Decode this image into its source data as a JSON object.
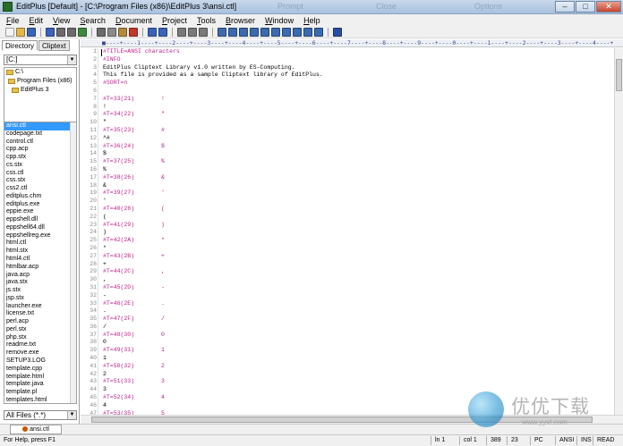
{
  "window": {
    "title": "EditPlus [Default] - [C:\\Program Files (x86)\\EditPlus 3\\ansi.ctl]",
    "ghost_text": [
      "Prompt",
      "Close",
      "Options"
    ]
  },
  "window_controls": {
    "minimize": "–",
    "maximize": "□",
    "close": "✕"
  },
  "menu": [
    {
      "key": "F",
      "rest": "ile"
    },
    {
      "key": "E",
      "rest": "dit"
    },
    {
      "key": "V",
      "rest": "iew"
    },
    {
      "key": "S",
      "rest": "earch"
    },
    {
      "key": "D",
      "rest": "ocument"
    },
    {
      "key": "P",
      "rest": "roject"
    },
    {
      "key": "T",
      "rest": "ools"
    },
    {
      "key": "B",
      "rest": "rowser"
    },
    {
      "key": "W",
      "rest": "indow"
    },
    {
      "key": "H",
      "rest": "elp"
    }
  ],
  "toolbar": {
    "icons": [
      "new-file-icon",
      "open-file-icon",
      "save-icon",
      "save-all-icon",
      "print-icon",
      "print-preview-icon",
      "spell-check-icon",
      "cut-icon",
      "copy-icon",
      "paste-icon",
      "delete-icon",
      "undo-icon",
      "redo-icon",
      "find-icon",
      "replace-icon",
      "go-to-icon",
      "word-wrap-icon",
      "ruler-icon",
      "line-number-icon",
      "screen-width-icon",
      "font-icon",
      "indent-icon",
      "outdent-icon",
      "column-select-icon",
      "html-toolbar-icon",
      "preview-browser-icon",
      "help-icon"
    ],
    "colors": [
      "#f4f4f4",
      "#e1b84a",
      "#3a63b8",
      "#3a63b8",
      "#6b6b6b",
      "#6b6b6b",
      "#3c8a3c",
      "#6b6b6b",
      "#8a8a8a",
      "#b38b3a",
      "#c0392b",
      "#3a63b8",
      "#3a63b8",
      "#7a7a7a",
      "#7a7a7a",
      "#7a7a7a",
      "#3a6ab0",
      "#3a6ab0",
      "#3a6ab0",
      "#3a6ab0",
      "#3a6ab0",
      "#3a6ab0",
      "#3a6ab0",
      "#3a6ab0",
      "#3a6ab0",
      "#3a6ab0",
      "#2a4fa0"
    ]
  },
  "left_panel": {
    "tabs": [
      "Directory",
      "Cliptext"
    ],
    "drive": "[C:]",
    "dirs": [
      "C:\\",
      "Program Files (x86)",
      "EditPlus 3"
    ],
    "files": [
      "ansi.ctl",
      "codepage.txt",
      "control.ctl",
      "cpp.acp",
      "cpp.stx",
      "cs.stx",
      "css.ctl",
      "css.stx",
      "css2.ctl",
      "editplus.chm",
      "editplus.exe",
      "eppie.exe",
      "eppshell.dll",
      "eppshell64.dll",
      "eppshellreg.exe",
      "html.ctl",
      "html.stx",
      "html4.ctl",
      "htmlbar.acp",
      "java.acp",
      "java.stx",
      "js.stx",
      "jsp.stx",
      "launcher.exe",
      "license.txt",
      "perl.acp",
      "perl.stx",
      "php.stx",
      "readme.txt",
      "remove.exe",
      "SETUP3.LOG",
      "template.cpp",
      "template.html",
      "template.java",
      "template.pl",
      "templates.html"
    ],
    "selected_file": "ansi.ctl",
    "filter": "All Files (*.*)"
  },
  "editor": {
    "ruler": "■----+----1----+----2----+----3----+----4----+----5----+----6----+----7----+----8----+----9----+----0----+----1----+----2----+----3----+----4----+",
    "lines": [
      {
        "n": "1",
        "t": "#TITLE=ANSI characters",
        "c": "m"
      },
      {
        "n": "2",
        "t": "#INFO",
        "c": "m"
      },
      {
        "n": "3",
        "t": "EditPlus Cliptext Library v1.0 written by ES-Computing.",
        "c": "p"
      },
      {
        "n": "4",
        "t": "This file is provided as a sample Cliptext library of EditPlus.",
        "c": "p"
      },
      {
        "n": "5",
        "t": "#SORT=n",
        "c": "m"
      },
      {
        "n": "6",
        "t": "",
        "c": "p"
      },
      {
        "n": "7",
        "t": "#T=33(21)",
        "c": "m",
        "ch": "!"
      },
      {
        "n": "8",
        "t": "!",
        "c": "p"
      },
      {
        "n": "9",
        "t": "#T=34(22)",
        "c": "m",
        "ch": "\""
      },
      {
        "n": "10",
        "t": "\"",
        "c": "p"
      },
      {
        "n": "11",
        "t": "#T=35(23)",
        "c": "m",
        "ch": "#"
      },
      {
        "n": "12",
        "t": "^#",
        "c": "p"
      },
      {
        "n": "13",
        "t": "#T=36(24)",
        "c": "m",
        "ch": "$"
      },
      {
        "n": "14",
        "t": "$",
        "c": "p"
      },
      {
        "n": "15",
        "t": "#T=37(25)",
        "c": "m",
        "ch": "%"
      },
      {
        "n": "16",
        "t": "%",
        "c": "p"
      },
      {
        "n": "17",
        "t": "#T=38(26)",
        "c": "m",
        "ch": "&"
      },
      {
        "n": "18",
        "t": "&",
        "c": "p"
      },
      {
        "n": "19",
        "t": "#T=39(27)",
        "c": "m",
        "ch": "'"
      },
      {
        "n": "20",
        "t": "'",
        "c": "p"
      },
      {
        "n": "21",
        "t": "#T=40(28)",
        "c": "m",
        "ch": "("
      },
      {
        "n": "22",
        "t": "(",
        "c": "p"
      },
      {
        "n": "23",
        "t": "#T=41(29)",
        "c": "m",
        "ch": ")"
      },
      {
        "n": "24",
        "t": ")",
        "c": "p"
      },
      {
        "n": "25",
        "t": "#T=42(2A)",
        "c": "m",
        "ch": "*"
      },
      {
        "n": "26",
        "t": "*",
        "c": "p"
      },
      {
        "n": "27",
        "t": "#T=43(2B)",
        "c": "m",
        "ch": "+"
      },
      {
        "n": "28",
        "t": "+",
        "c": "p"
      },
      {
        "n": "29",
        "t": "#T=44(2C)",
        "c": "m",
        "ch": ","
      },
      {
        "n": "30",
        "t": ",",
        "c": "p"
      },
      {
        "n": "31",
        "t": "#T=45(2D)",
        "c": "m",
        "ch": "-"
      },
      {
        "n": "32",
        "t": "-",
        "c": "p"
      },
      {
        "n": "33",
        "t": "#T=46(2E)",
        "c": "m",
        "ch": "."
      },
      {
        "n": "34",
        "t": ".",
        "c": "p"
      },
      {
        "n": "35",
        "t": "#T=47(2F)",
        "c": "m",
        "ch": "/"
      },
      {
        "n": "36",
        "t": "/",
        "c": "p"
      },
      {
        "n": "37",
        "t": "#T=48(30)",
        "c": "m",
        "ch": "0"
      },
      {
        "n": "38",
        "t": "0",
        "c": "p"
      },
      {
        "n": "39",
        "t": "#T=49(31)",
        "c": "m",
        "ch": "1"
      },
      {
        "n": "40",
        "t": "1",
        "c": "p"
      },
      {
        "n": "41",
        "t": "#T=50(32)",
        "c": "m",
        "ch": "2"
      },
      {
        "n": "42",
        "t": "2",
        "c": "p"
      },
      {
        "n": "43",
        "t": "#T=51(33)",
        "c": "m",
        "ch": "3"
      },
      {
        "n": "44",
        "t": "3",
        "c": "p"
      },
      {
        "n": "45",
        "t": "#T=52(34)",
        "c": "m",
        "ch": "4"
      },
      {
        "n": "46",
        "t": "4",
        "c": "p"
      },
      {
        "n": "47",
        "t": "#T=53(35)",
        "c": "m",
        "ch": "5"
      }
    ]
  },
  "doc_tab": "ansi.ctl",
  "status": {
    "help": "For Help, press F1",
    "ln": "ln 1",
    "col": "col 1",
    "chars": "389",
    "pos": "23",
    "os": "PC",
    "encoding": "ANSI",
    "ins": "INS",
    "read": "READ"
  },
  "watermark": {
    "text": "优优下载",
    "url": "www.yyxt.com"
  }
}
